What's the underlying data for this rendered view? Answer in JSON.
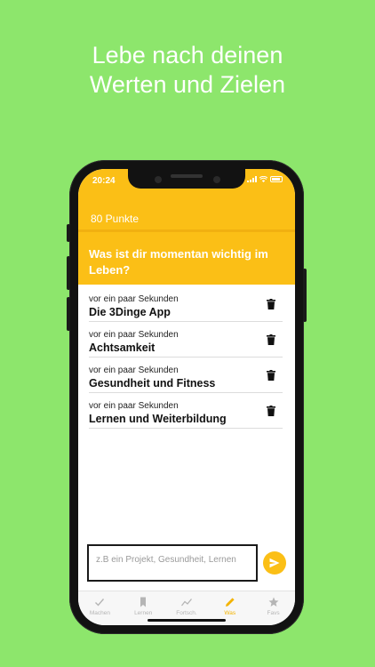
{
  "headline": {
    "line1": "Lebe nach deinen",
    "line2": "Werten und Zielen"
  },
  "status": {
    "time": "20:24"
  },
  "header": {
    "points": "80 Punkte",
    "question": "Was ist dir momentan wichtig im Leben?"
  },
  "items": [
    {
      "when": "vor ein paar Sekunden",
      "title": "Die 3Dinge App"
    },
    {
      "when": "vor ein paar Sekunden",
      "title": "Achtsamkeit"
    },
    {
      "when": "vor ein paar Sekunden",
      "title": "Gesundheit und Fitness"
    },
    {
      "when": "vor ein paar Sekunden",
      "title": "Lernen und Weiterbildung"
    }
  ],
  "input": {
    "placeholder": "z.B ein Projekt, Gesundheit, Lernen",
    "value": ""
  },
  "tabs": [
    {
      "label": "Machen",
      "icon": "check-icon",
      "active": false
    },
    {
      "label": "Lernen",
      "icon": "bookmark-icon",
      "active": false
    },
    {
      "label": "Fortsch.",
      "icon": "trend-icon",
      "active": false
    },
    {
      "label": "Was",
      "icon": "pencil-icon",
      "active": true
    },
    {
      "label": "Favs",
      "icon": "star-icon",
      "active": false
    }
  ],
  "colors": {
    "background": "#8de66c",
    "accent": "#fbbf16",
    "inactive": "#b5b5b5"
  }
}
